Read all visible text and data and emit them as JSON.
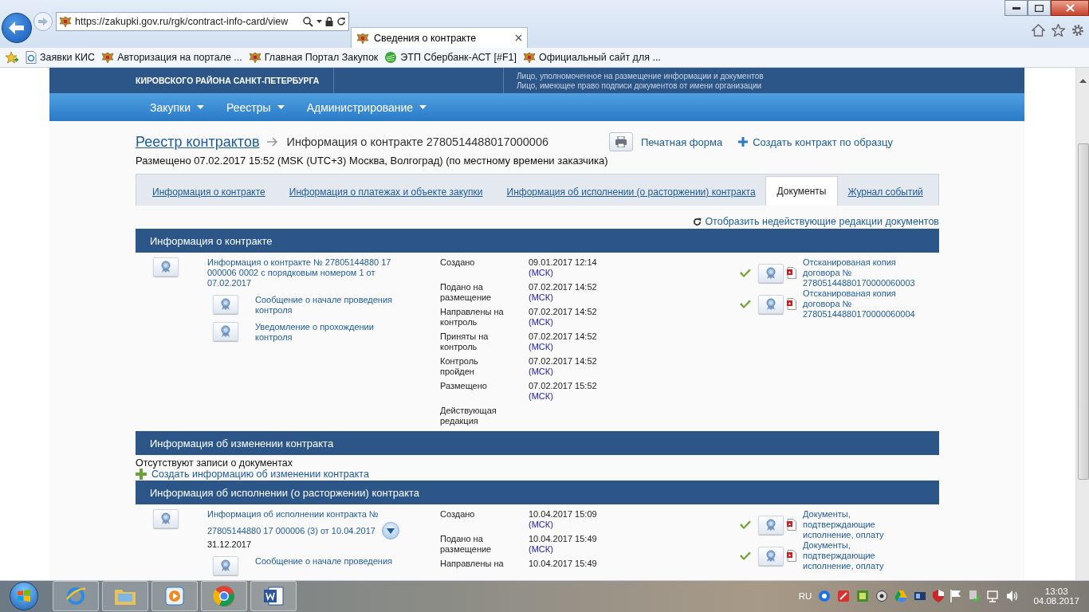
{
  "browser": {
    "url": "https://zakupki.gov.ru/rgk/contract-info-card/view",
    "tabs": [
      {
        "title": "Сведения о контракте",
        "selected": true
      }
    ],
    "favorites": [
      {
        "label": "Заявки  КИС",
        "kind": "ie"
      },
      {
        "label": "Авторизация на портале ...",
        "kind": "crest"
      },
      {
        "label": "Главная Портал Закупок",
        "kind": "crest"
      },
      {
        "label": "ЭТП Сбербанк-АСТ [#F1]",
        "kind": "green"
      },
      {
        "label": "Официальный сайт для ...",
        "kind": "crest"
      }
    ]
  },
  "header": {
    "org_name": "КИРОВСКОГО РАЙОНА САНКТ-ПЕТЕРБУРГА",
    "roles": [
      "Лицо, уполномоченное на размещение информации и документов",
      "Лицо, имеющее право подписи документов от имени организации"
    ]
  },
  "nav": [
    "Закупки",
    "Реестры",
    "Администрирование"
  ],
  "breadcrumb": {
    "link": "Реестр контрактов",
    "current": "Информация о контракте 2780514488017000006"
  },
  "actions": [
    {
      "label": "Печатная форма",
      "kind": "print"
    },
    {
      "label": "Создать контракт по образцу",
      "kind": "plus"
    }
  ],
  "posted": "Размещено 07.02.2017 15:52 (MSK (UTC+3) Москва, Волгоград) (по местному времени заказчика)",
  "tabs": [
    {
      "label": "Информация о контракте",
      "selected": false
    },
    {
      "label": "Информация о платежах и объекте закупки",
      "selected": false
    },
    {
      "label": "Информация об исполнении (о расторжении) контракта",
      "selected": false
    },
    {
      "label": "Документы",
      "selected": true
    },
    {
      "label": "Журнал событий",
      "selected": false
    }
  ],
  "toggle_link": "Отобразить недействующие редакции документов",
  "sections": [
    {
      "title": "Информация о контракте",
      "kind": "document",
      "document": {
        "title": "Информация о контракте № 27805144880 17 000006 0002 с порядковым номером 1 от 07.02.2017",
        "children": [
          {
            "title": "Сообщение о начале проведения контроля"
          },
          {
            "title": "Уведомление о прохождении контроля"
          }
        ],
        "statuses": [
          {
            "label": "Создано",
            "time": "09.01.2017 12:14",
            "tz": "(МСК)"
          },
          {
            "label": "Подано на размещение",
            "time": "07.02.2017 14:52",
            "tz": "(МСК)"
          },
          {
            "label": "Направлены на контроль",
            "time": "07.02.2017 14:52",
            "tz": "(МСК)"
          },
          {
            "label": "Приняты на контроль",
            "time": "07.02.2017 14:52",
            "tz": "(МСК)"
          },
          {
            "label": "Контроль пройден",
            "time": "07.02.2017 14:52",
            "tz": "(МСК)"
          },
          {
            "label": "Размещено",
            "time": "07.02.2017 15:52",
            "tz": "(МСК)"
          },
          {
            "label": "Действующая редакция"
          }
        ],
        "attachments": [
          {
            "title": "Отсканированая копия договора № 27805144880170000060003",
            "verified": true
          },
          {
            "title": "Отсканированая копия договора № 27805144880170000060004",
            "verified": true
          }
        ]
      }
    },
    {
      "title": "Информация об изменении контракта",
      "kind": "empty",
      "empty_text": "Отсутствуют записи о документах",
      "create_link": "Создать информацию об изменении контракта"
    },
    {
      "title": "Информация об исполнении (о расторжении) контракта",
      "kind": "document",
      "document": {
        "title": "Информация об исполнении контракта №",
        "title_line2": "27805144880 17 000006 (3) от 10.04.2017",
        "subtitle": "31.12.2017",
        "expandable": true,
        "children": [
          {
            "title": "Сообщение о начале проведения"
          }
        ],
        "statuses": [
          {
            "label": "Создано",
            "time": "10.04.2017 15:09",
            "tz": "(МСК)"
          },
          {
            "label": "Подано на размещение",
            "time": "10.04.2017 15:49",
            "tz": "(МСК)"
          },
          {
            "label": "Направлены на",
            "time": "10.04.2017 15:49"
          }
        ],
        "attachments": [
          {
            "title": "Документы, подтверждающие исполнение, оплату",
            "verified": true
          },
          {
            "title": "Документы, подтверждающие исполнение, оплату",
            "verified": true
          }
        ]
      }
    }
  ],
  "taskbar": {
    "lang": "RU",
    "time": "13:03",
    "date": "04.08.2017"
  }
}
